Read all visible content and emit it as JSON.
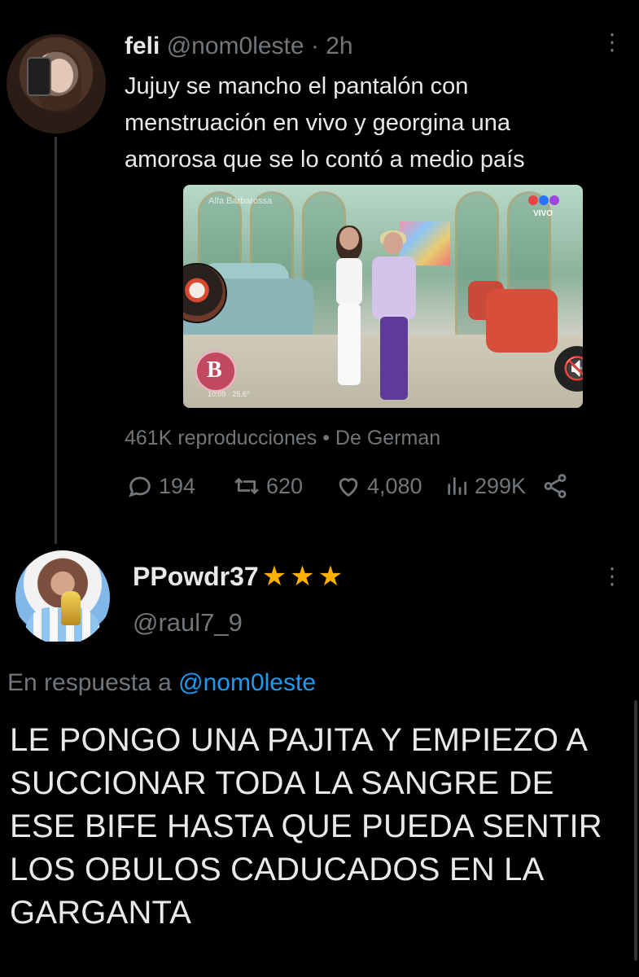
{
  "tweet": {
    "name": "feli",
    "handle": "@nom0leste",
    "time": "· 2h",
    "text": "Jujuy se mancho el pantalón con menstruación en vivo y georgina una amorosa que se lo contó a medio país",
    "views_text": "461K reproducciones",
    "from_text": "• De German",
    "counts": {
      "replies": "194",
      "retweets": "620",
      "likes": "4,080",
      "views": "299K"
    },
    "video": {
      "channel_badge": "VIVO",
      "timestamp": "10:09 · 25.6°",
      "watermark": "Alfa Barbarossa"
    }
  },
  "reply": {
    "name": "PPowdr37",
    "stars": [
      "★",
      "★",
      "★"
    ],
    "handle": "@raul7_9",
    "reply_label": "En respuesta a",
    "reply_mention": "@nom0leste",
    "text": "LE PONGO UNA PAJITA Y EMPIEZO A SUCCIONAR TODA LA SANGRE DE ESE BIFE HASTA QUE PUEDA SENTIR LOS OBULOS CADUCADOS EN LA GARGANTA"
  },
  "ui": {
    "more_icon": "more-vertical-icon",
    "reply_icon": "comment-icon",
    "retweet_icon": "retweet-icon",
    "like_icon": "heart-icon",
    "views_icon": "bar-chart-icon",
    "share_icon": "share-icon",
    "mute_icon": "volume-muted-icon",
    "mention_color": "#1d9bf0",
    "star_color": "#ffb000"
  }
}
